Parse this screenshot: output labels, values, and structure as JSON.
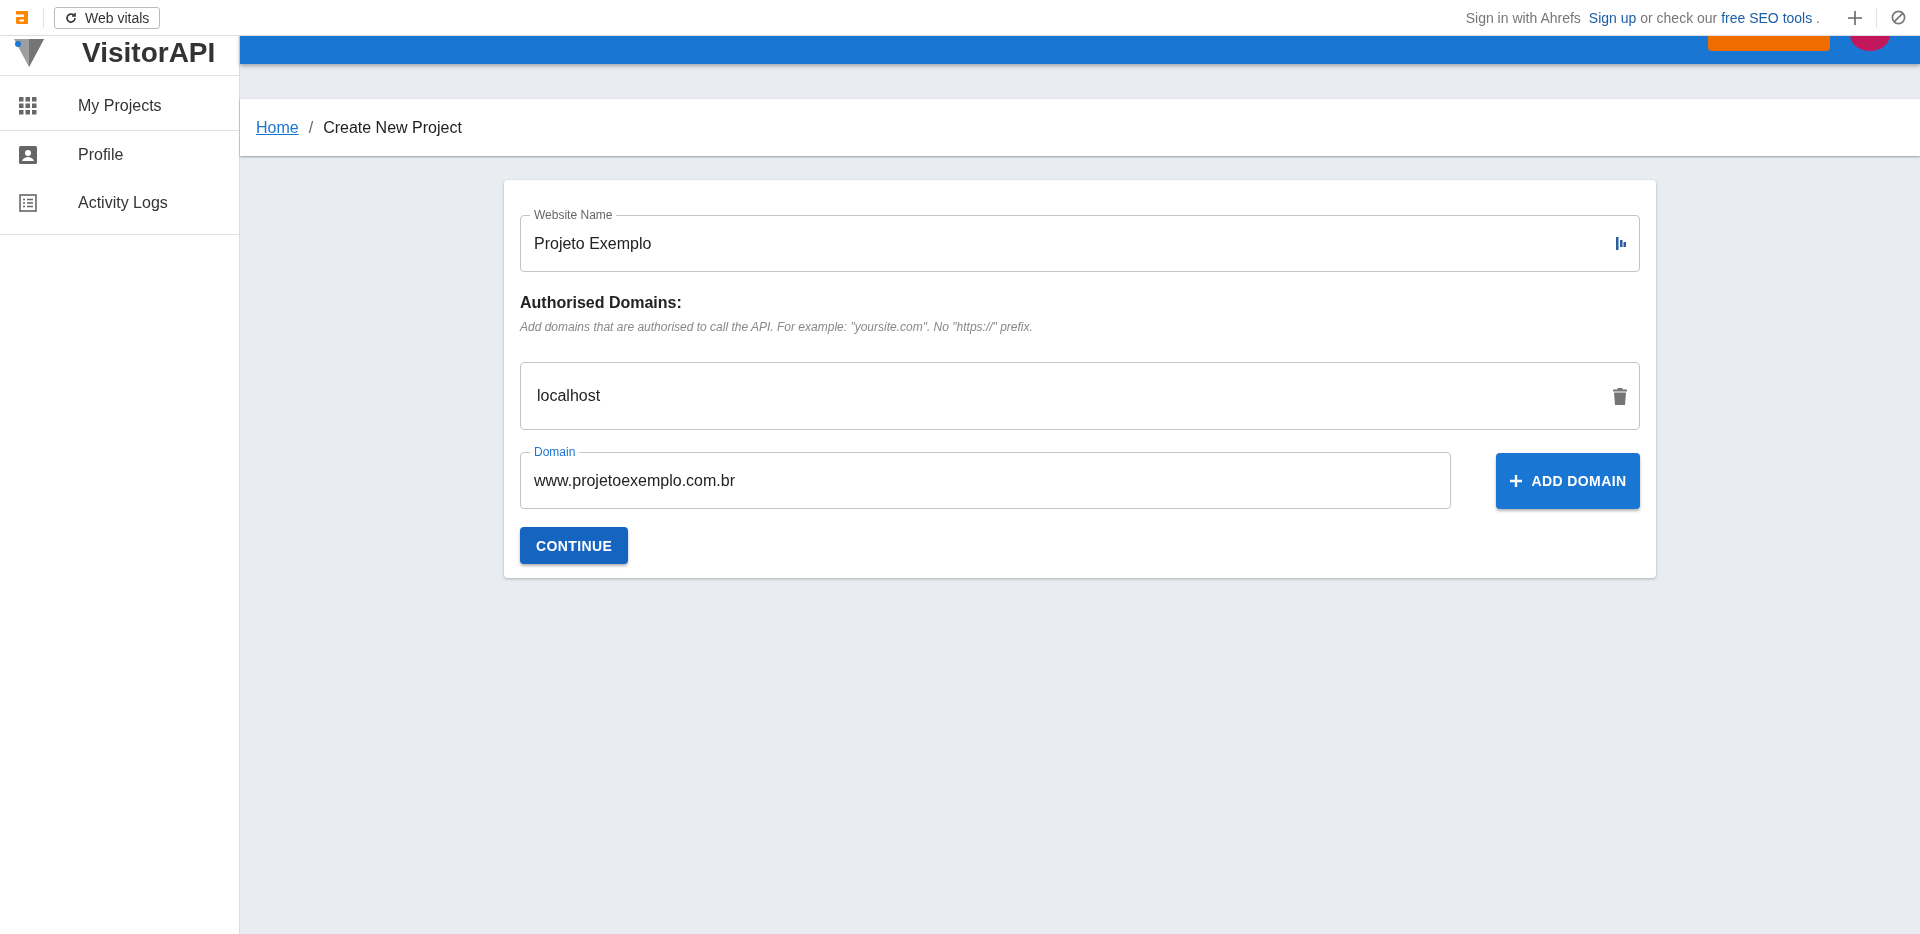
{
  "browser_toolbar": {
    "web_vitals_button": "Web vitals",
    "sign_in_text": "Sign in with Ahrefs",
    "promo": [
      {
        "kind": "link",
        "text": "Sign up"
      },
      {
        "kind": "text",
        "text": "or check our"
      },
      {
        "kind": "link",
        "text": "free SEO tools"
      },
      {
        "kind": "text",
        "text": "."
      }
    ]
  },
  "sidebar": {
    "app_name": "VisitorAPI",
    "items": [
      {
        "label": "My Projects",
        "selected": false
      },
      {
        "label": "Profile",
        "selected": false
      },
      {
        "label": "Activity Logs",
        "selected": false
      }
    ]
  },
  "breadcrumb": {
    "home_link": "Home",
    "separator": "/",
    "current": "Create New Project"
  },
  "form": {
    "website_name": {
      "label": "Website Name",
      "value": "Projeto Exemplo",
      "focused": false
    },
    "authorised_domains": {
      "heading": "Authorised Domains:",
      "hint": "Add domains that are authorised to call the API. For example: \"yoursite.com\". No \"https://\" prefix.",
      "domains": [
        {
          "value": "localhost"
        }
      ]
    },
    "domain_field": {
      "label": "Domain",
      "value": "www.projetoexemplo.com.br",
      "focused": true
    },
    "add_domain_button": "ADD DOMAIN",
    "continue_button": "CONTINUE"
  }
}
